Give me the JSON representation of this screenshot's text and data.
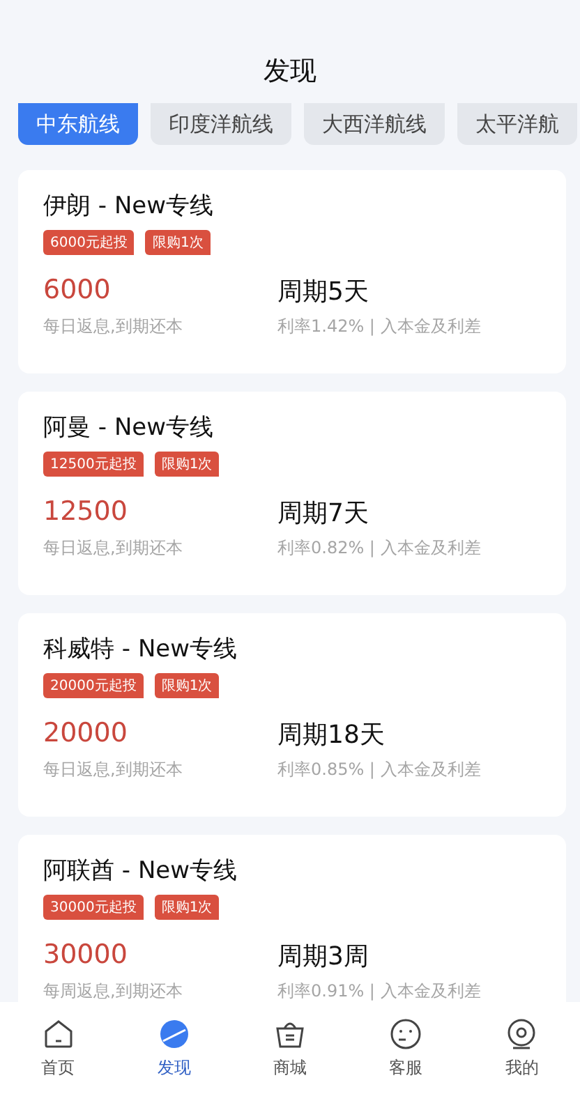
{
  "header": {
    "title": "发现"
  },
  "tabs": [
    {
      "label": "中东航线",
      "selected": true
    },
    {
      "label": "印度洋航线",
      "selected": false
    },
    {
      "label": "大西洋航线",
      "selected": false
    },
    {
      "label": "太平洋航",
      "selected": false
    }
  ],
  "products": [
    {
      "name": "伊朗 - New专线",
      "tags": [
        "6000元起投",
        "限购1次"
      ],
      "amount": "6000",
      "payout": "每日返息,到期还本",
      "period": "周期5天",
      "rate": "利率1.42% | 入本金及利差"
    },
    {
      "name": "阿曼 - New专线",
      "tags": [
        "12500元起投",
        "限购1次"
      ],
      "amount": "12500",
      "payout": "每日返息,到期还本",
      "period": "周期7天",
      "rate": "利率0.82% | 入本金及利差"
    },
    {
      "name": "科威特 - New专线",
      "tags": [
        "20000元起投",
        "限购1次"
      ],
      "amount": "20000",
      "payout": "每日返息,到期还本",
      "period": "周期18天",
      "rate": "利率0.85% | 入本金及利差"
    },
    {
      "name": "阿联酋 - New专线",
      "tags": [
        "30000元起投",
        "限购1次"
      ],
      "amount": "30000",
      "payout": "每周返息,到期还本",
      "period": "周期3周",
      "rate": "利率0.91% | 入本金及利差"
    }
  ],
  "nav": [
    {
      "kind": "home",
      "label": "首页",
      "selected": false
    },
    {
      "kind": "discover",
      "label": "发现",
      "selected": true
    },
    {
      "kind": "shop",
      "label": "商城",
      "selected": false
    },
    {
      "kind": "service",
      "label": "客服",
      "selected": false
    },
    {
      "kind": "profile",
      "label": "我的",
      "selected": false
    }
  ]
}
